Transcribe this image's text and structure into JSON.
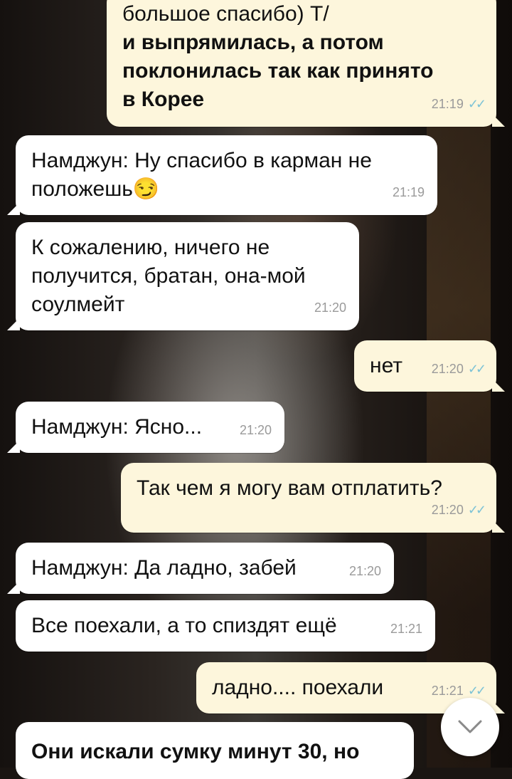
{
  "messages": [
    {
      "id": "m1",
      "direction": "out",
      "lines": [
        "большое спасибо) Т/"
      ],
      "bold_lines": [
        "и выпрямилась, а потом поклонилась так как принято в Корее"
      ],
      "time": "21:19",
      "ticks": "✓✓"
    },
    {
      "id": "m2",
      "direction": "in",
      "text": "Намджун: Ну спасибо в карман не положешь😏",
      "time": "21:19"
    },
    {
      "id": "m3",
      "direction": "in",
      "text": "К сожалению, ничего не получится, братан, она-мой соулмейт",
      "time": "21:20"
    },
    {
      "id": "m4",
      "direction": "out",
      "text": "нет",
      "time": "21:20",
      "ticks": "✓✓"
    },
    {
      "id": "m5",
      "direction": "in",
      "text": "Намджун: Ясно...",
      "time": "21:20"
    },
    {
      "id": "m6",
      "direction": "out",
      "text": "Так чем я могу вам отплатить?",
      "time": "21:20",
      "ticks": "✓✓"
    },
    {
      "id": "m7",
      "direction": "in",
      "text": "Намджун: Да ладно, забей",
      "time": "21:20"
    },
    {
      "id": "m8",
      "direction": "in",
      "text": "Все поехали, а то спиздят ещё",
      "time": "21:21"
    },
    {
      "id": "m9",
      "direction": "out",
      "text": "ладно.... поехали",
      "time": "21:21",
      "ticks": "✓✓"
    },
    {
      "id": "m10",
      "direction": "in",
      "bold_text": "Они искали сумку минут 30, но"
    }
  ],
  "scroll_button": {
    "icon": "chevron-down-icon"
  },
  "colors": {
    "incoming": "#ffffff",
    "outgoing": "#fdf6dc",
    "read_ticks": "#7ec3d6",
    "time": "#9a9a9a"
  }
}
